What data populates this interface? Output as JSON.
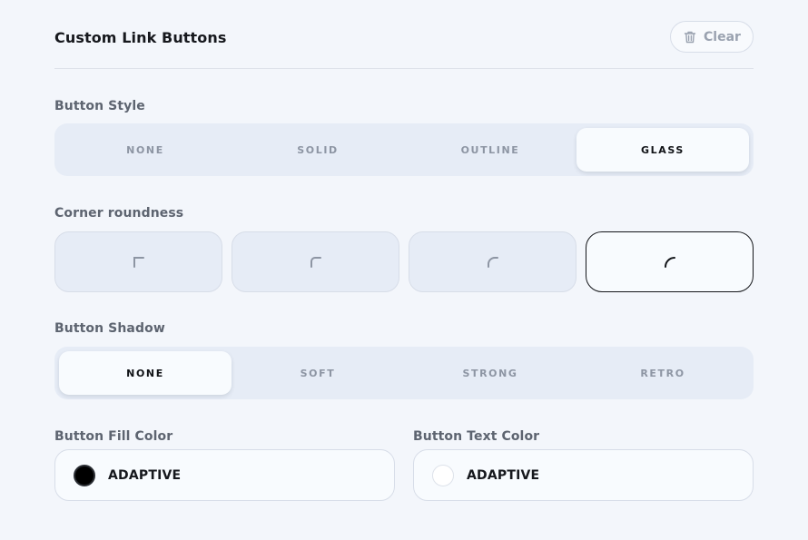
{
  "header": {
    "title": "Custom Link Buttons",
    "clear_label": "Clear"
  },
  "button_style": {
    "label": "Button Style",
    "options": [
      "NONE",
      "SOLID",
      "OUTLINE",
      "GLASS"
    ],
    "selected": "GLASS"
  },
  "corner_roundness": {
    "label": "Corner roundness",
    "options": [
      "square-corner-icon",
      "slight-round-corner-icon",
      "round-corner-icon",
      "full-round-corner-icon"
    ],
    "selected_index": 3
  },
  "button_shadow": {
    "label": "Button Shadow",
    "options": [
      "NONE",
      "SOFT",
      "STRONG",
      "RETRO"
    ],
    "selected": "NONE"
  },
  "fill_color": {
    "label": "Button Fill Color",
    "value": "ADAPTIVE",
    "swatch": "#000000"
  },
  "text_color": {
    "label": "Button Text Color",
    "value": "ADAPTIVE",
    "swatch": "#ffffff"
  }
}
